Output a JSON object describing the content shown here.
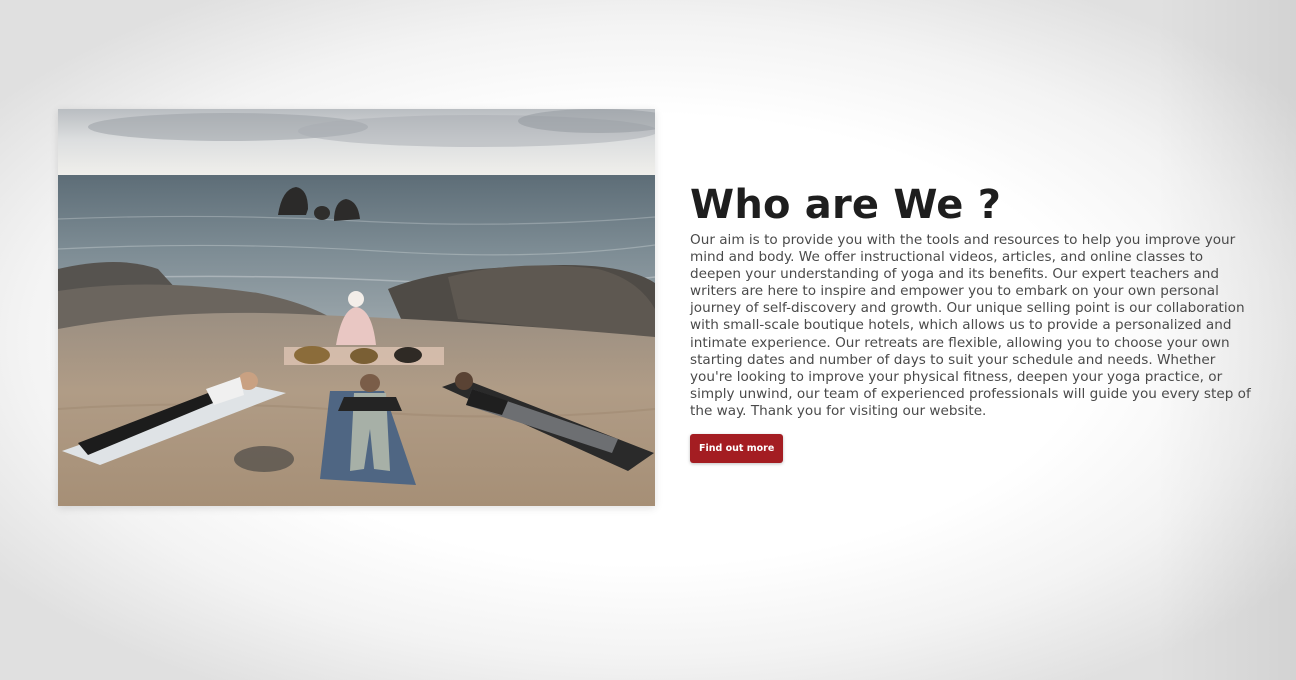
{
  "about": {
    "heading": "Who are We ?",
    "description": "Our aim is to provide you with the tools and resources to help you improve your mind and body. We offer instructional videos, articles, and online classes to deepen your understanding of yoga and its benefits. Our expert teachers and writers are here to inspire and empower you to embark on your own personal journey of self-discovery and growth. Our unique selling point is our collaboration with small-scale boutique hotels, which allows us to provide a personalized and intimate experience. Our retreats are flexible, allowing you to choose your own starting dates and number of days to suit your schedule and needs. Whether you're looking to improve your physical fitness, deepen your yoga practice, or simply unwind, our team of experienced professionals will guide you every step of the way. Thank you for visiting our website.",
    "button_label": "Find out more"
  },
  "photo": {
    "icon": "yoga-sound-bath-photo"
  },
  "colors": {
    "accent": "#a41d22",
    "heading": "#1e1e1e",
    "body_text": "#4a4a4a"
  }
}
